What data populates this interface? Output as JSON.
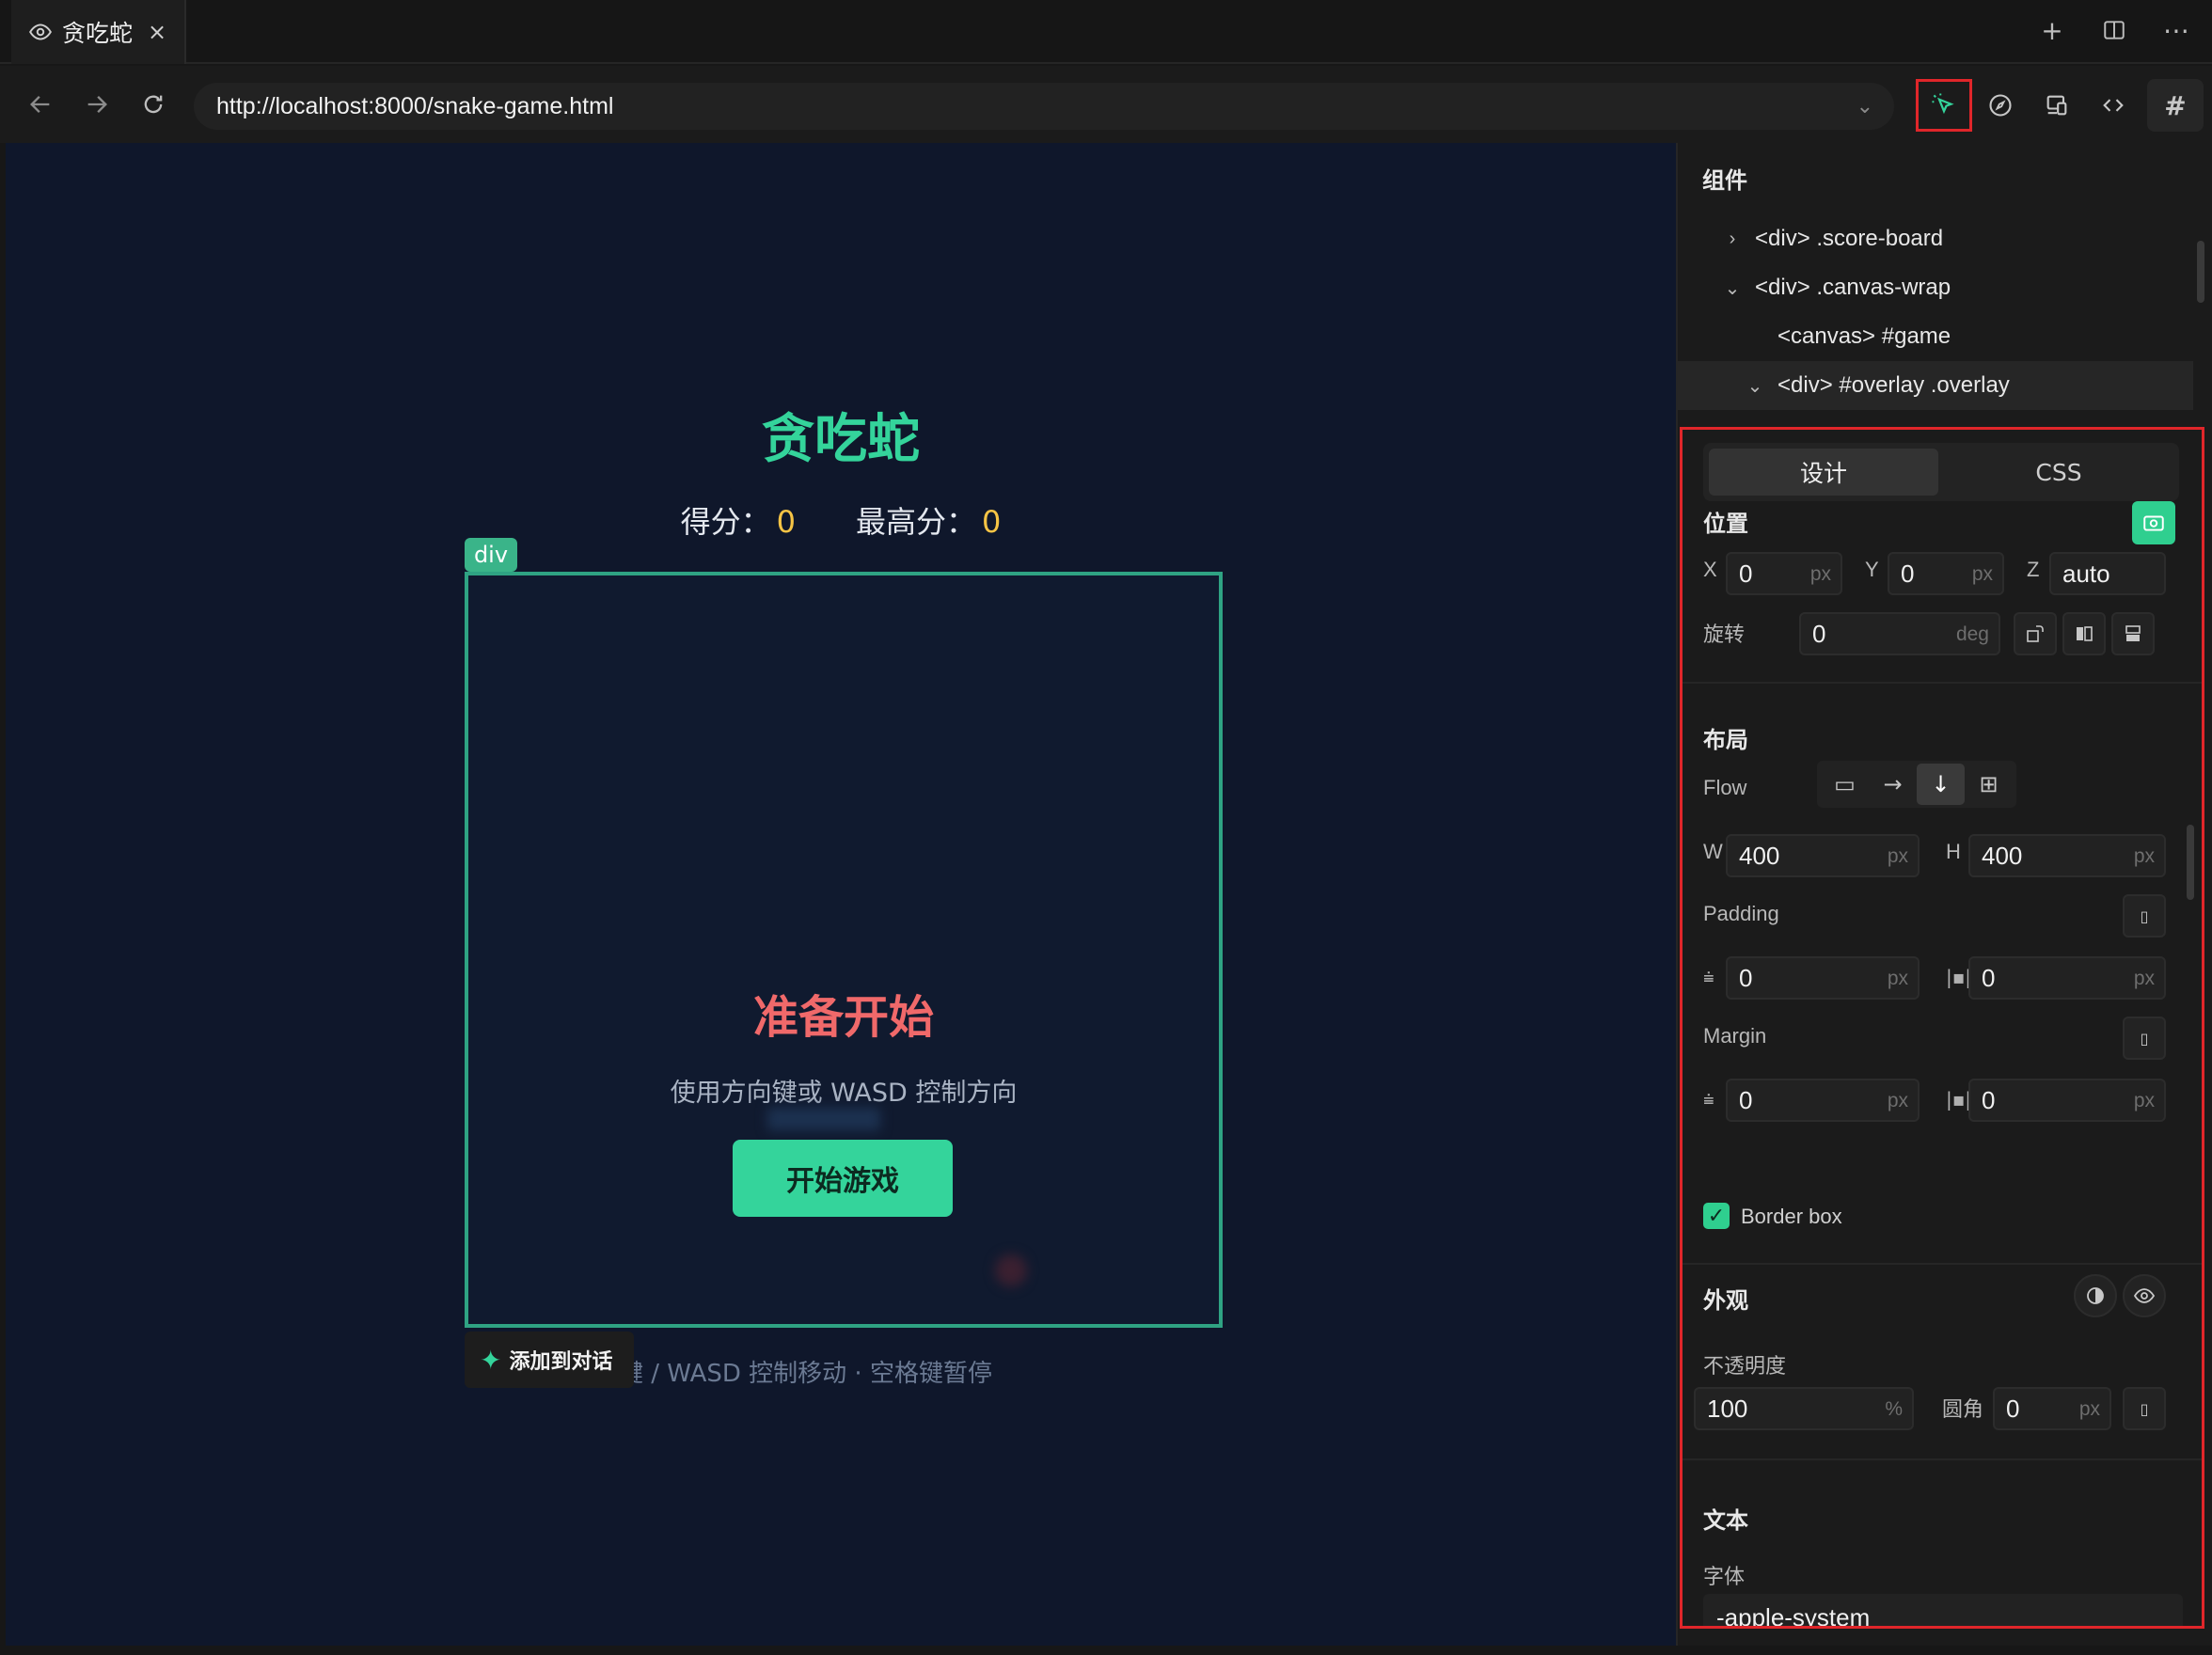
{
  "tab": {
    "title": "贪吃蛇",
    "close": "×"
  },
  "tabbar_icons": {
    "plus": "+",
    "more": "⋯"
  },
  "address": {
    "url": "http://localhost:8000/snake-game.html",
    "hash": "#"
  },
  "game": {
    "title": "贪吃蛇",
    "score_label": "得分：",
    "score": "0",
    "best_label": "最高分：",
    "best": "0",
    "selected_tag": "div",
    "overlay_title": "准备开始",
    "overlay_sub": "使用方向键或 WASD 控制方向",
    "start_button": "开始游戏",
    "hint": "方向键 / WASD 控制移动 · 空格键暂停",
    "add_to_chat": "添加到对话"
  },
  "panel": {
    "heading": "组件",
    "tree": [
      {
        "label": "<div> .score-board",
        "chevron": "›"
      },
      {
        "label": "<div> .canvas-wrap",
        "chevron": "⌄"
      },
      {
        "label": "<canvas> #game",
        "chevron": ""
      },
      {
        "label": "<div> #overlay .overlay",
        "chevron": "⌄"
      }
    ],
    "tabs": {
      "design": "设计",
      "css": "CSS"
    },
    "position": {
      "title": "位置",
      "x_label": "X",
      "x": "0",
      "x_unit": "px",
      "y_label": "Y",
      "y": "0",
      "y_unit": "px",
      "z_label": "Z",
      "z": "auto",
      "rotate_label": "旋转",
      "rotate": "0",
      "rotate_unit": "deg"
    },
    "layout": {
      "title": "布局",
      "flow_label": "Flow",
      "w_label": "W",
      "w": "400",
      "w_unit": "px",
      "h_label": "H",
      "h": "400",
      "h_unit": "px",
      "padding_label": "Padding",
      "padding_v": "0",
      "padding_h": "0",
      "margin_label": "Margin",
      "margin_v": "0",
      "margin_h": "0",
      "unit": "px",
      "border_box_label": "Border box",
      "border_box_checked": true
    },
    "appearance": {
      "title": "外观",
      "opacity_label": "不透明度",
      "opacity": "100",
      "opacity_unit": "%",
      "radius_label": "圆角",
      "radius": "0",
      "radius_unit": "px"
    },
    "text": {
      "title": "文本",
      "font_label": "字体",
      "font": "-apple-system"
    }
  },
  "colors": {
    "accent": "#34d49b",
    "score": "#f6c445",
    "overlay_title": "#f0696a",
    "highlight_border": "#e0262a",
    "canvas_bg": "#0f172b"
  }
}
